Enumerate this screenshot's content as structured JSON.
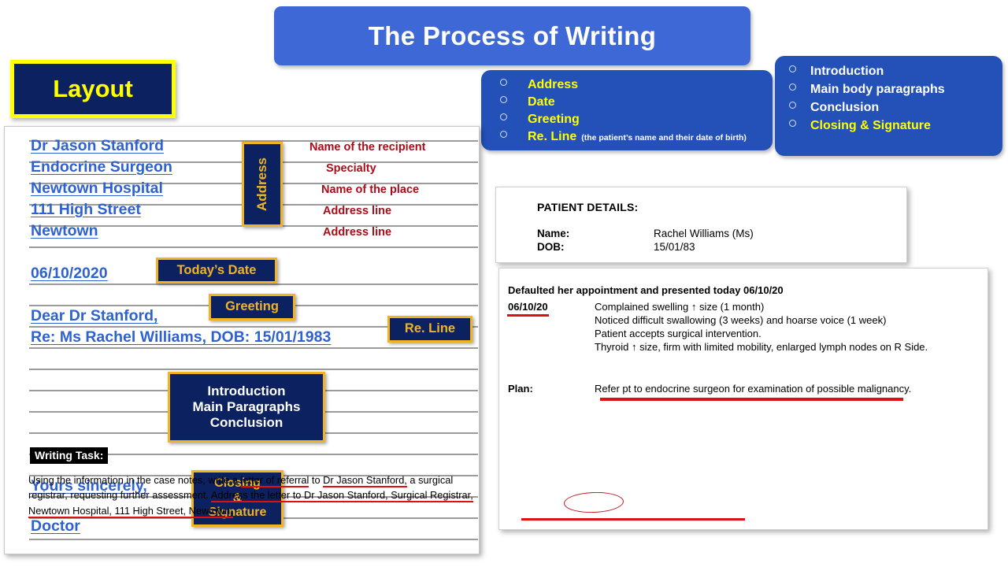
{
  "title": {
    "text": "The Process of Writing",
    "accent": "#3e68d6"
  },
  "layout_badge": {
    "label": "Layout",
    "bg": "#0c2260",
    "border": "#ffff00",
    "fg": "#ffff00"
  },
  "bullets_left": {
    "items": [
      {
        "label": "Address",
        "note": ""
      },
      {
        "label": "Date",
        "note": ""
      },
      {
        "label": "Greeting",
        "note": ""
      },
      {
        "label": "Re. Line",
        "note": "(the patient’s name and their date of birth)"
      }
    ]
  },
  "bullets_right": {
    "items": [
      {
        "label": "Introduction",
        "color": "white"
      },
      {
        "label": "Main body paragraphs",
        "color": "white"
      },
      {
        "label": "Conclusion",
        "color": "white"
      },
      {
        "label": "Closing & Signature",
        "color": "yellow"
      }
    ]
  },
  "letter": {
    "lines": [
      "Dr Jason Stanford",
      "Endocrine Surgeon",
      "Newtown Hospital",
      "111 High Street",
      "Newtown",
      "06/10/2020",
      "Dear Dr Stanford,",
      "Re: Ms Rachel Williams, DOB: 15/01/1983",
      "Yours sincerely,",
      "Doctor"
    ],
    "red_notes": [
      "Name of the recipient",
      "Specialty",
      "Name of the place",
      "Address line",
      "Address line"
    ],
    "callouts": {
      "address": "Address",
      "date": "Today’s Date",
      "greeting": "Greeting",
      "reline": "Re. Line",
      "body_line1": "Introduction",
      "body_line2": "Main Paragraphs",
      "body_line3": "Conclusion",
      "closing_line1": "Closing",
      "closing_line2": "&",
      "closing_line3": "Signature"
    }
  },
  "patient_details": {
    "heading": "PATIENT DETAILS:",
    "name_key": "Name:",
    "name_value": "Rachel Williams (Ms)",
    "dob_key": "DOB:",
    "dob_value": "15/01/83"
  },
  "case_notes": {
    "headline": "Defaulted her appointment and presented today 06/10/20",
    "date": "06/10/20",
    "entries": [
      "Complained swelling ↑ size (1 month)",
      "Noticed difficult swallowing (3 weeks) and hoarse voice (1 week)",
      "Patient accepts surgical intervention.",
      "Thyroid ↑  size, firm with limited mobility, enlarged lymph nodes on R Side."
    ],
    "plan_key": "Plan:",
    "plan_value": "Refer pt to endocrine surgeon for examination of possible malignancy.",
    "task_title": "Writing Task:",
    "task_body_1": "Using the information in the case notes, write a ",
    "task_body_ref": "letter of referral",
    "task_body_2": " to ",
    "task_body_dr": "Dr Jason Stanford,",
    "task_body_3": " a surgical registrar, ",
    "task_body_requesting": "requesting",
    "task_body_4": " further assessment. ",
    "task_body_address": "Address the letter to Dr Jason Stanford, Surgical Registrar, Newtown Hospital, 111 High Street, Newtown.",
    "annotation_color": "#e01010"
  }
}
